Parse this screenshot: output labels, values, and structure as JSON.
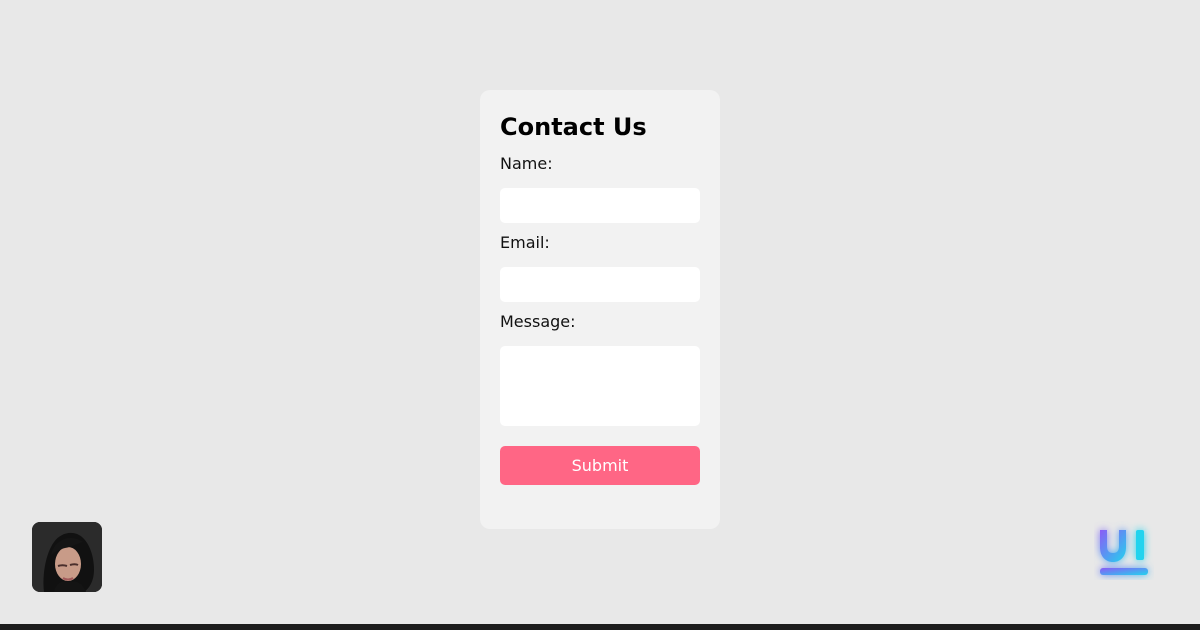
{
  "form": {
    "title": "Contact Us",
    "name_label": "Name:",
    "email_label": "Email:",
    "message_label": "Message:",
    "name_value": "",
    "email_value": "",
    "message_value": "",
    "submit_label": "Submit"
  },
  "colors": {
    "background": "#e8e8e8",
    "card": "#f2f2f2",
    "submit": "#ff6685",
    "logo_gradient_start": "#8b5cf6",
    "logo_gradient_end": "#22d3ee"
  },
  "icons": {
    "avatar": "user-avatar",
    "logo": "ui-logo-icon"
  }
}
